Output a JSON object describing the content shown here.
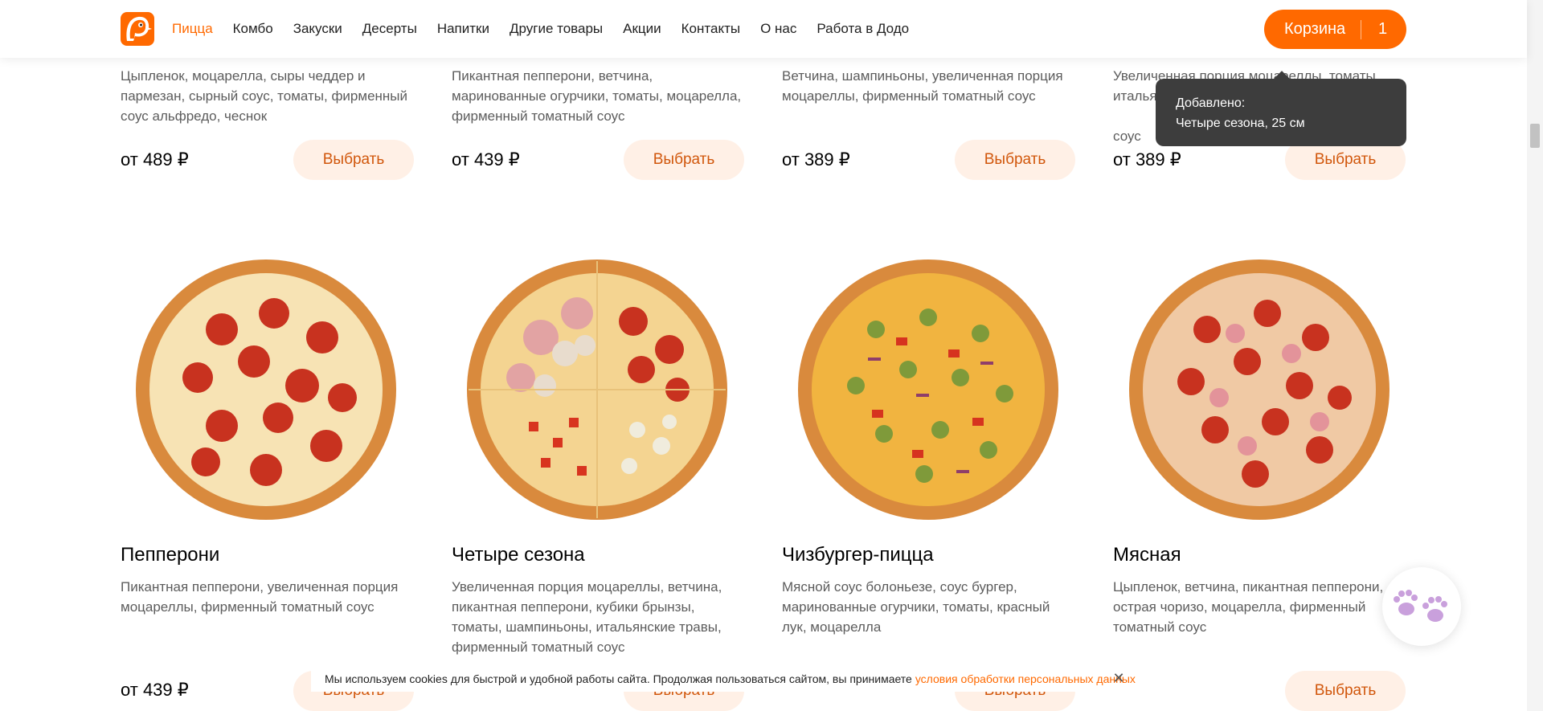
{
  "nav": {
    "items": [
      {
        "label": "Пицца",
        "active": true
      },
      {
        "label": "Комбо",
        "active": false
      },
      {
        "label": "Закуски",
        "active": false
      },
      {
        "label": "Десерты",
        "active": false
      },
      {
        "label": "Напитки",
        "active": false
      },
      {
        "label": "Другие товары",
        "active": false
      },
      {
        "label": "Акции",
        "active": false
      },
      {
        "label": "Контакты",
        "active": false
      },
      {
        "label": "О нас",
        "active": false
      },
      {
        "label": "Работа в Додо",
        "active": false
      }
    ],
    "cart": {
      "label": "Корзина",
      "count": "1"
    }
  },
  "top_row": [
    {
      "desc": "Цыпленок, моцарелла, сыры чеддер и пармезан, сырный соус, томаты, фирменный соус альфредо, чеснок",
      "price": "от 489 ₽",
      "button": "Выбрать"
    },
    {
      "desc": "Пикантная пепперони, ветчина, маринованные огурчики, томаты, моцарелла, фирменный томатный соус",
      "price": "от 439 ₽",
      "button": "Выбрать"
    },
    {
      "desc": "Ветчина, шампиньоны, увеличенная порция моцареллы, фирменный томатный соус",
      "price": "от 389 ₽",
      "button": "Выбрать"
    },
    {
      "desc": "Увеличенная порция моцареллы, томаты, италья",
      "desc_tail": "соус",
      "price": "от 389 ₽",
      "button": "Выбрать"
    }
  ],
  "bottom_row": [
    {
      "title": "Пепперони",
      "desc": "Пикантная пепперони, увеличенная порция моцареллы, фирменный томатный соус",
      "price": "от 439 ₽",
      "button": "Выбрать"
    },
    {
      "title": "Четыре сезона",
      "desc": "Увеличенная порция моцареллы, ветчина, пикантная пепперони, кубики брынзы, томаты, шампиньоны, итальянские травы, фирменный томатный соус",
      "price": "",
      "button": "Выбрать"
    },
    {
      "title": "Чизбургер-пицца",
      "desc": "Мясной соус болоньезе, соус бургер, маринованные огурчики, томаты, красный лук, моцарелла",
      "price": "",
      "button": "Выбрать"
    },
    {
      "title": "Мясная",
      "desc": "Цыпленок, ветчина, пикантная пепперони, острая чоризо, моцарелла, фирменный томатный соус",
      "price": "",
      "button": "Выбрать"
    }
  ],
  "toast": {
    "line1": "Добавлено:",
    "line2": "Четыре сезона, 25 см"
  },
  "cookie": {
    "text": "Мы используем cookies для быстрой и удобной работы сайта. Продолжая пользоваться сайтом, вы принимаете",
    "link": "условия обработки персональных данных",
    "close": "✕"
  },
  "colors": {
    "accent": "#ff6900",
    "button_bg": "#fff0e6",
    "toast_bg": "#3d3d3d"
  },
  "icons": [
    "dodo-logo-icon",
    "close-icon",
    "paw-icon",
    "pizza-image"
  ]
}
